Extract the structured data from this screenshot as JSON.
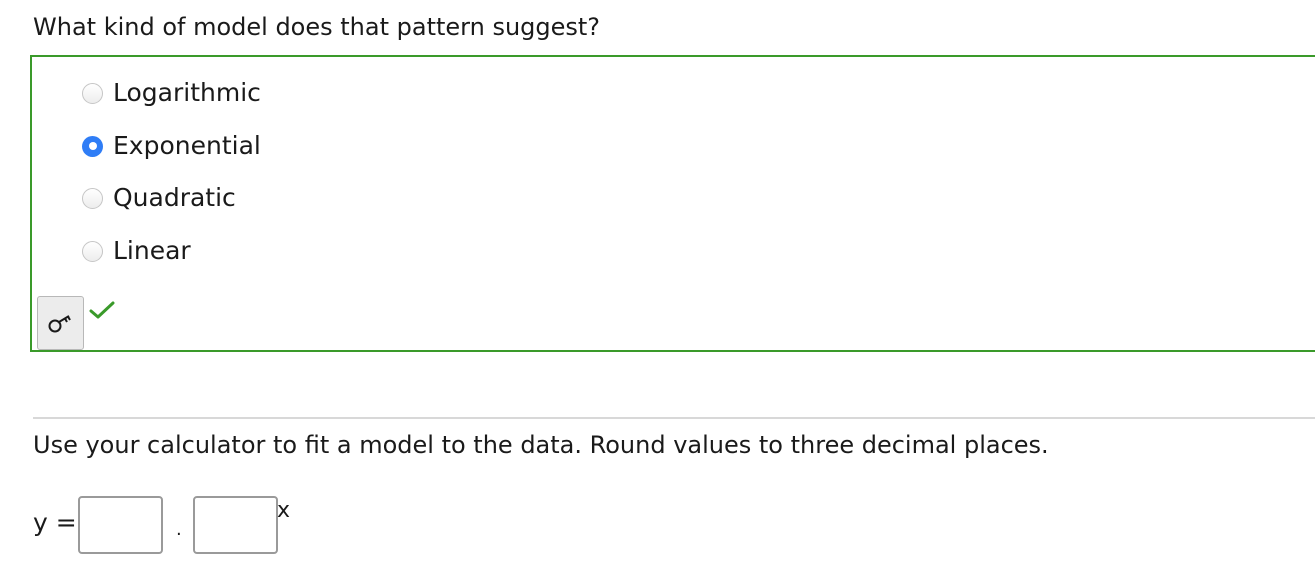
{
  "question": {
    "text": "What kind of model does that pattern suggest?"
  },
  "options": [
    {
      "label": "Logarithmic",
      "checked": false
    },
    {
      "label": "Exponential",
      "checked": true
    },
    {
      "label": "Quadratic",
      "checked": false
    },
    {
      "label": "Linear",
      "checked": false
    }
  ],
  "feedback": {
    "status": "correct",
    "check_color": "#3a9a2a",
    "key_icon": "key-icon",
    "check_icon": "checkmark-icon"
  },
  "instruction": {
    "text": "Use your calculator to fit a model to the data. Round values to three decimal places."
  },
  "equation": {
    "lhs": "y =",
    "coefficient_value": "",
    "operator": "·",
    "base_value": "",
    "exponent": "x"
  },
  "colors": {
    "accent": "#2f7df6",
    "border_correct": "#3a9a2a"
  }
}
